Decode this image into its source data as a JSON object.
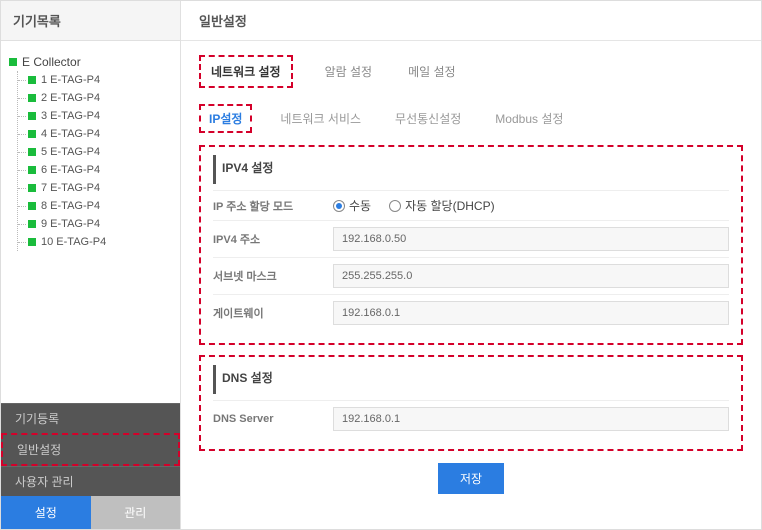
{
  "sidebar": {
    "title": "기기목록",
    "root": "E Collector",
    "items": [
      "1 E-TAG-P4",
      "2 E-TAG-P4",
      "3 E-TAG-P4",
      "4 E-TAG-P4",
      "5 E-TAG-P4",
      "6 E-TAG-P4",
      "7 E-TAG-P4",
      "8 E-TAG-P4",
      "9 E-TAG-P4",
      "10 E-TAG-P4"
    ],
    "bottom": {
      "device_reg": "기기등록",
      "general_settings": "일반설정",
      "user_mgmt": "사용자 관리"
    },
    "tabs": {
      "settings": "설정",
      "manage": "관리"
    }
  },
  "main": {
    "title": "일반설정",
    "top_tabs": {
      "network": "네트워크 설정",
      "alarm": "알람 설정",
      "mail": "메일 설정"
    },
    "sub_tabs": {
      "ip": "IP설정",
      "net_service": "네트워크 서비스",
      "wireless": "무선통신설정",
      "modbus": "Modbus 설정"
    },
    "ipv4": {
      "title": "IPV4 설정",
      "mode_label": "IP 주소 할당 모드",
      "mode_manual": "수동",
      "mode_dhcp": "자동 할당(DHCP)",
      "addr_label": "IPV4 주소",
      "addr_value": "192.168.0.50",
      "mask_label": "서브넷 마스크",
      "mask_value": "255.255.255.0",
      "gw_label": "게이트웨이",
      "gw_value": "192.168.0.1"
    },
    "dns": {
      "title": "DNS 설정",
      "server_label": "DNS Server",
      "server_value": "192.168.0.1"
    },
    "save": "저장"
  }
}
